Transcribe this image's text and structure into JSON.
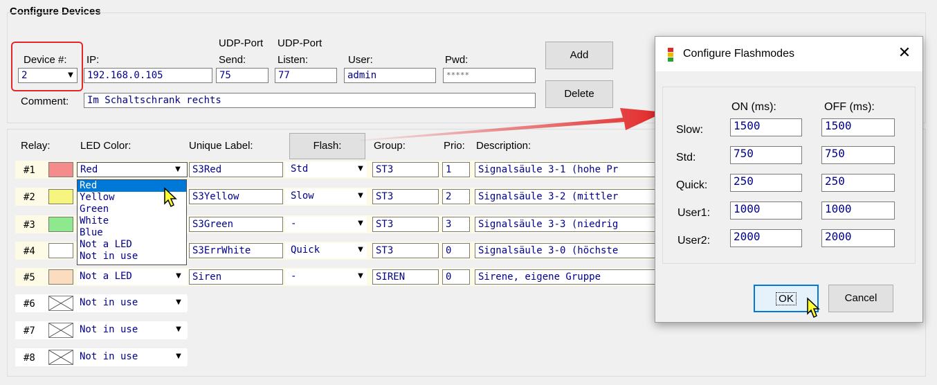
{
  "section_title": "Configure Devices",
  "device_form": {
    "device_label": "Device #:",
    "device_value": "2",
    "ip_label": "IP:",
    "ip_value": "192.168.0.105",
    "udp_port_header": "UDP-Port",
    "send_label": "Send:",
    "send_value": "75",
    "listen_label": "Listen:",
    "listen_value": "77",
    "user_label": "User:",
    "user_value": "admin",
    "pwd_label": "Pwd:",
    "pwd_value": "*****",
    "comment_label": "Comment:",
    "comment_value": "Im Schaltschrank rechts",
    "add_button": "Add",
    "delete_button": "Delete"
  },
  "relay_table": {
    "headers": {
      "relay": "Relay:",
      "led_color": "LED Color:",
      "unique_label": "Unique Label:",
      "flash_button": "Flash:",
      "group": "Group:",
      "prio": "Prio:",
      "description": "Description:"
    },
    "rows": [
      {
        "num": "#1",
        "color": "#f48c8c",
        "led": "Red",
        "label": "S3Red",
        "flash": "Std",
        "group": "ST3",
        "prio": "1",
        "description": "Signalsäule 3-1 (hohe Pr"
      },
      {
        "num": "#2",
        "color": "#f5f57f",
        "led": "Yellow",
        "label": "S3Yellow",
        "flash": "Slow",
        "group": "ST3",
        "prio": "2",
        "description": "Signalsäule 3-2 (mittler"
      },
      {
        "num": "#3",
        "color": "#8ee88e",
        "led": "Green",
        "label": "S3Green",
        "flash": "-",
        "group": "ST3",
        "prio": "3",
        "description": "Signalsäule 3-3 (niedrig"
      },
      {
        "num": "#4",
        "color": "#ffffff",
        "led": "White",
        "label": "S3ErrWhite",
        "flash": "Quick",
        "group": "ST3",
        "prio": "0",
        "description": "Signalsäule 3-0 (höchste"
      },
      {
        "num": "#5",
        "color": "#fcdcbf",
        "led": "Not a LED",
        "label": "Siren",
        "flash": "-",
        "group": "SIREN",
        "prio": "0",
        "description": "Sirene, eigene Gruppe"
      },
      {
        "num": "#6",
        "led": "Not in use"
      },
      {
        "num": "#7",
        "led": "Not in use"
      },
      {
        "num": "#8",
        "led": "Not in use"
      }
    ],
    "led_dropdown_options": [
      "Red",
      "Yellow",
      "Green",
      "White",
      "Blue",
      "Not a LED",
      "Not in use"
    ],
    "led_dropdown_selected": "Red"
  },
  "flash_dialog": {
    "title": "Configure Flashmodes",
    "on_header": "ON (ms):",
    "off_header": "OFF (ms):",
    "modes": [
      {
        "name": "Slow:",
        "on": "1500",
        "off": "1500"
      },
      {
        "name": "Std:",
        "on": "750",
        "off": "750"
      },
      {
        "name": "Quick:",
        "on": "250",
        "off": "250"
      },
      {
        "name": "User1:",
        "on": "1000",
        "off": "1000"
      },
      {
        "name": "User2:",
        "on": "2000",
        "off": "2000"
      }
    ],
    "ok_button": "OK",
    "cancel_button": "Cancel"
  },
  "colors": {
    "highlight_red": "#e32727",
    "selection_blue": "#0078d7",
    "input_text": "#00008b"
  },
  "icons": [
    "close-icon",
    "traffic-light-icon",
    "dropdown-arrow-icon",
    "cursor-icon",
    "cross-box-icon"
  ]
}
